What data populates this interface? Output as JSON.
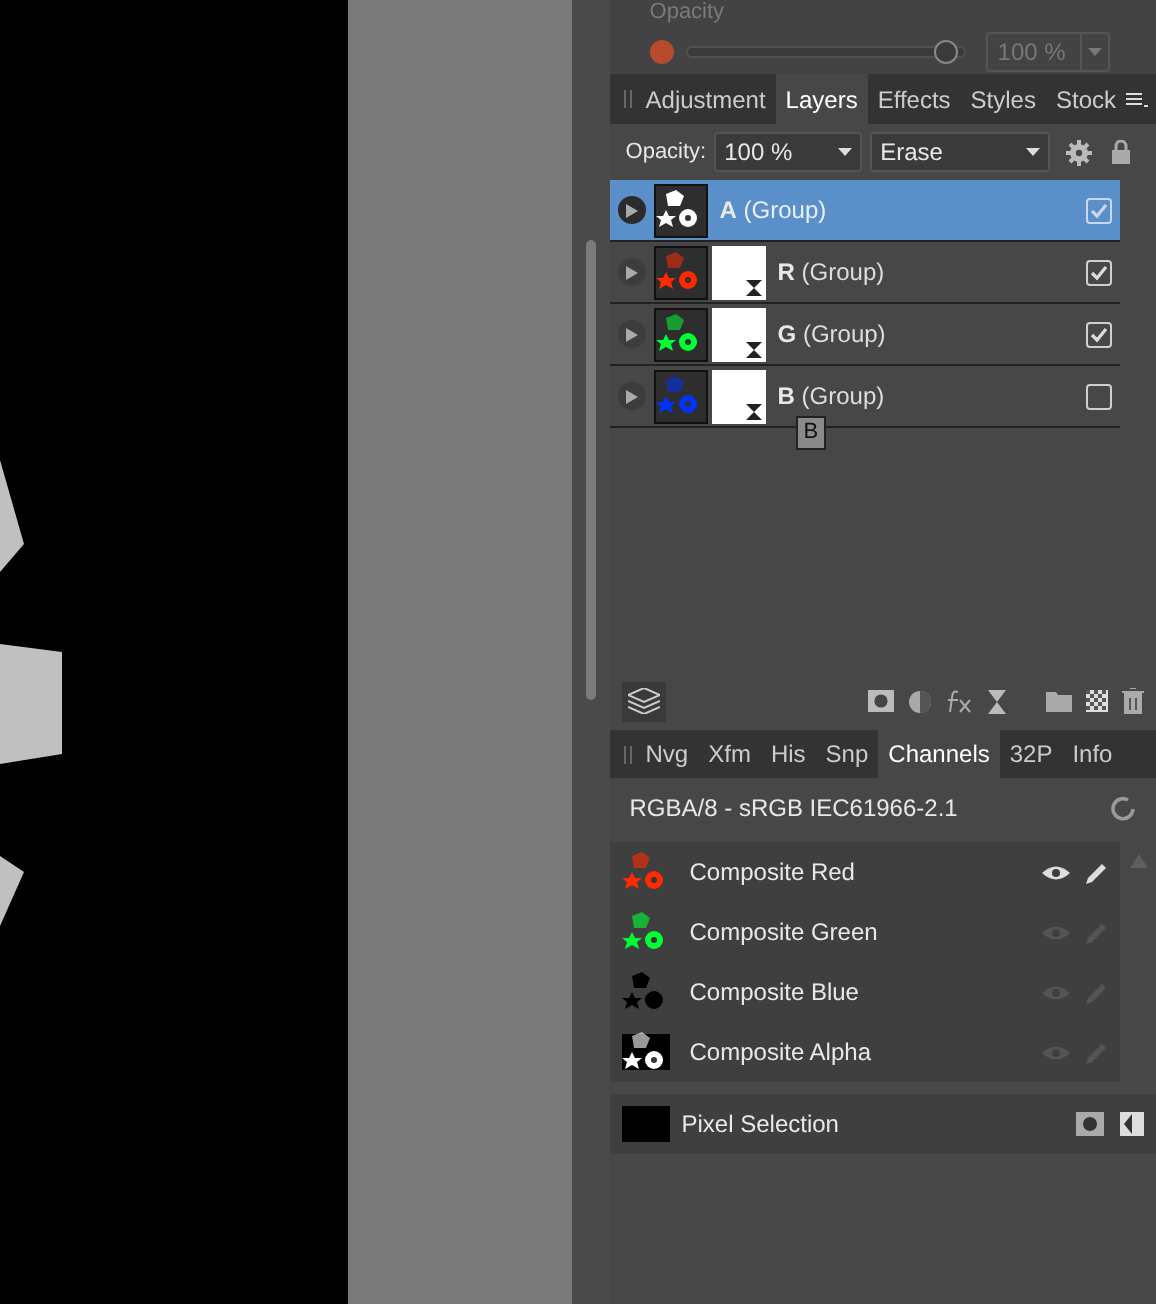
{
  "context_bar": {
    "label": "Opacity",
    "disabled": true,
    "level": 0.97,
    "value": "100 %"
  },
  "layers_tabs": [
    {
      "label": "Adjustment",
      "selected": false
    },
    {
      "label": "Layers",
      "selected": true
    },
    {
      "label": "Effects",
      "selected": false
    },
    {
      "label": "Styles",
      "selected": false
    },
    {
      "label": "Stock",
      "selected": false
    }
  ],
  "layer_options": {
    "opacity_label": "Opacity:",
    "opacity": "100 %",
    "blend_mode": "Erase"
  },
  "layers": [
    {
      "letter": "A",
      "name": "(Group)",
      "selected": true,
      "visible": true,
      "has_mask": false,
      "color": "#ffffff"
    },
    {
      "letter": "R",
      "name": "(Group)",
      "selected": false,
      "visible": true,
      "has_mask": true,
      "color": "#ff2a00"
    },
    {
      "letter": "G",
      "name": "(Group)",
      "selected": false,
      "visible": true,
      "has_mask": true,
      "color": "#00ff33"
    },
    {
      "letter": "B",
      "name": "(Group)",
      "selected": false,
      "visible": false,
      "has_mask": true,
      "color": "#0033ff"
    }
  ],
  "tooltip": "B",
  "studio_tabs": [
    {
      "label": "Nvg",
      "selected": false
    },
    {
      "label": "Xfm",
      "selected": false
    },
    {
      "label": "His",
      "selected": false
    },
    {
      "label": "Snp",
      "selected": false
    },
    {
      "label": "Channels",
      "selected": true
    },
    {
      "label": "32P",
      "selected": false
    },
    {
      "label": "Info",
      "selected": false
    }
  ],
  "color_format": "RGBA/8 - sRGB IEC61966-2.1",
  "channels": [
    {
      "name": "Composite Red",
      "active": true,
      "color": "#ff2a00"
    },
    {
      "name": "Composite Green",
      "active": false,
      "color": "#00ff33"
    },
    {
      "name": "Composite Blue",
      "active": false,
      "color": "#000000"
    },
    {
      "name": "Composite Alpha",
      "active": false,
      "color": "#ffffff"
    }
  ],
  "pixel_selection": "Pixel Selection"
}
